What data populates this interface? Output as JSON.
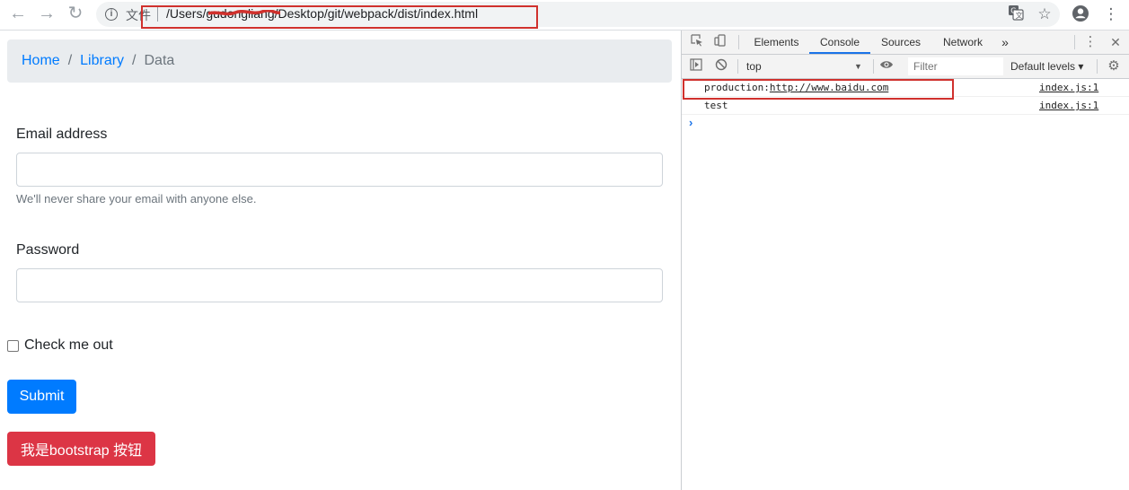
{
  "browser": {
    "file_label": "文件",
    "url": "/Users/gudongliang/Desktop/git/webpack/dist/index.html",
    "icons": {
      "back": "back-arrow-icon",
      "forward": "forward-arrow-icon",
      "reload": "reload-icon",
      "info": "info-icon",
      "translate": "translate-icon",
      "bookmark": "star-icon",
      "profile": "account-icon",
      "menu": "kebab-menu-icon"
    }
  },
  "breadcrumb": {
    "home": "Home",
    "library": "Library",
    "current": "Data",
    "separator": "/"
  },
  "form": {
    "email_label": "Email address",
    "email_value": "",
    "email_help": "We'll never share your email with anyone else.",
    "password_label": "Password",
    "password_value": "",
    "checkbox_label": "Check me out",
    "submit_label": "Submit",
    "danger_label": "我是bootstrap 按钮"
  },
  "devtools": {
    "tabs": [
      "Elements",
      "Console",
      "Sources",
      "Network"
    ],
    "active_tab": "Console",
    "more_tabs": "»",
    "context": "top",
    "filter_placeholder": "Filter",
    "levels": "Default levels ▾",
    "logs": [
      {
        "prefix": "production:",
        "link": "http://www.baidu.com",
        "source": "index.js:1"
      },
      {
        "prefix": "test",
        "link": "",
        "source": "index.js:1"
      }
    ],
    "prompt_symbol": "›"
  },
  "colors": {
    "primary": "#007bff",
    "danger": "#dc3545",
    "annotation": "#d0312d",
    "devtools_accent": "#1a73e8"
  }
}
